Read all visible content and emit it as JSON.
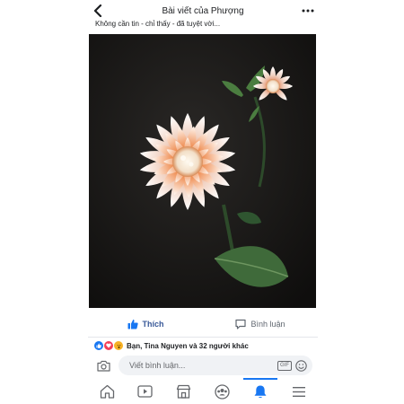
{
  "header": {
    "title": "Bài viết của Phượng"
  },
  "post": {
    "caption": "Không cần tin - chỉ thấy - đã tuyệt vời...",
    "image_subject": "orange-white-dahlia-flower"
  },
  "actions": {
    "like_label": "Thích",
    "comment_label": "Bình luận"
  },
  "reactions": {
    "summary": "Bạn, Tina Nguyen và 32 người khác",
    "types": [
      "like",
      "love",
      "wow"
    ]
  },
  "comment_box": {
    "placeholder": "Viết bình luận...",
    "gif_label": "GIF"
  },
  "tabs": [
    {
      "icon": "home-icon"
    },
    {
      "icon": "video-icon"
    },
    {
      "icon": "marketplace-icon"
    },
    {
      "icon": "groups-icon"
    },
    {
      "icon": "bell-icon",
      "active": true
    },
    {
      "icon": "menu-icon"
    }
  ],
  "colors": {
    "accent": "#1877f2",
    "like_text": "#385898",
    "secondary_text": "#606770",
    "input_bg": "#f0f2f5"
  }
}
